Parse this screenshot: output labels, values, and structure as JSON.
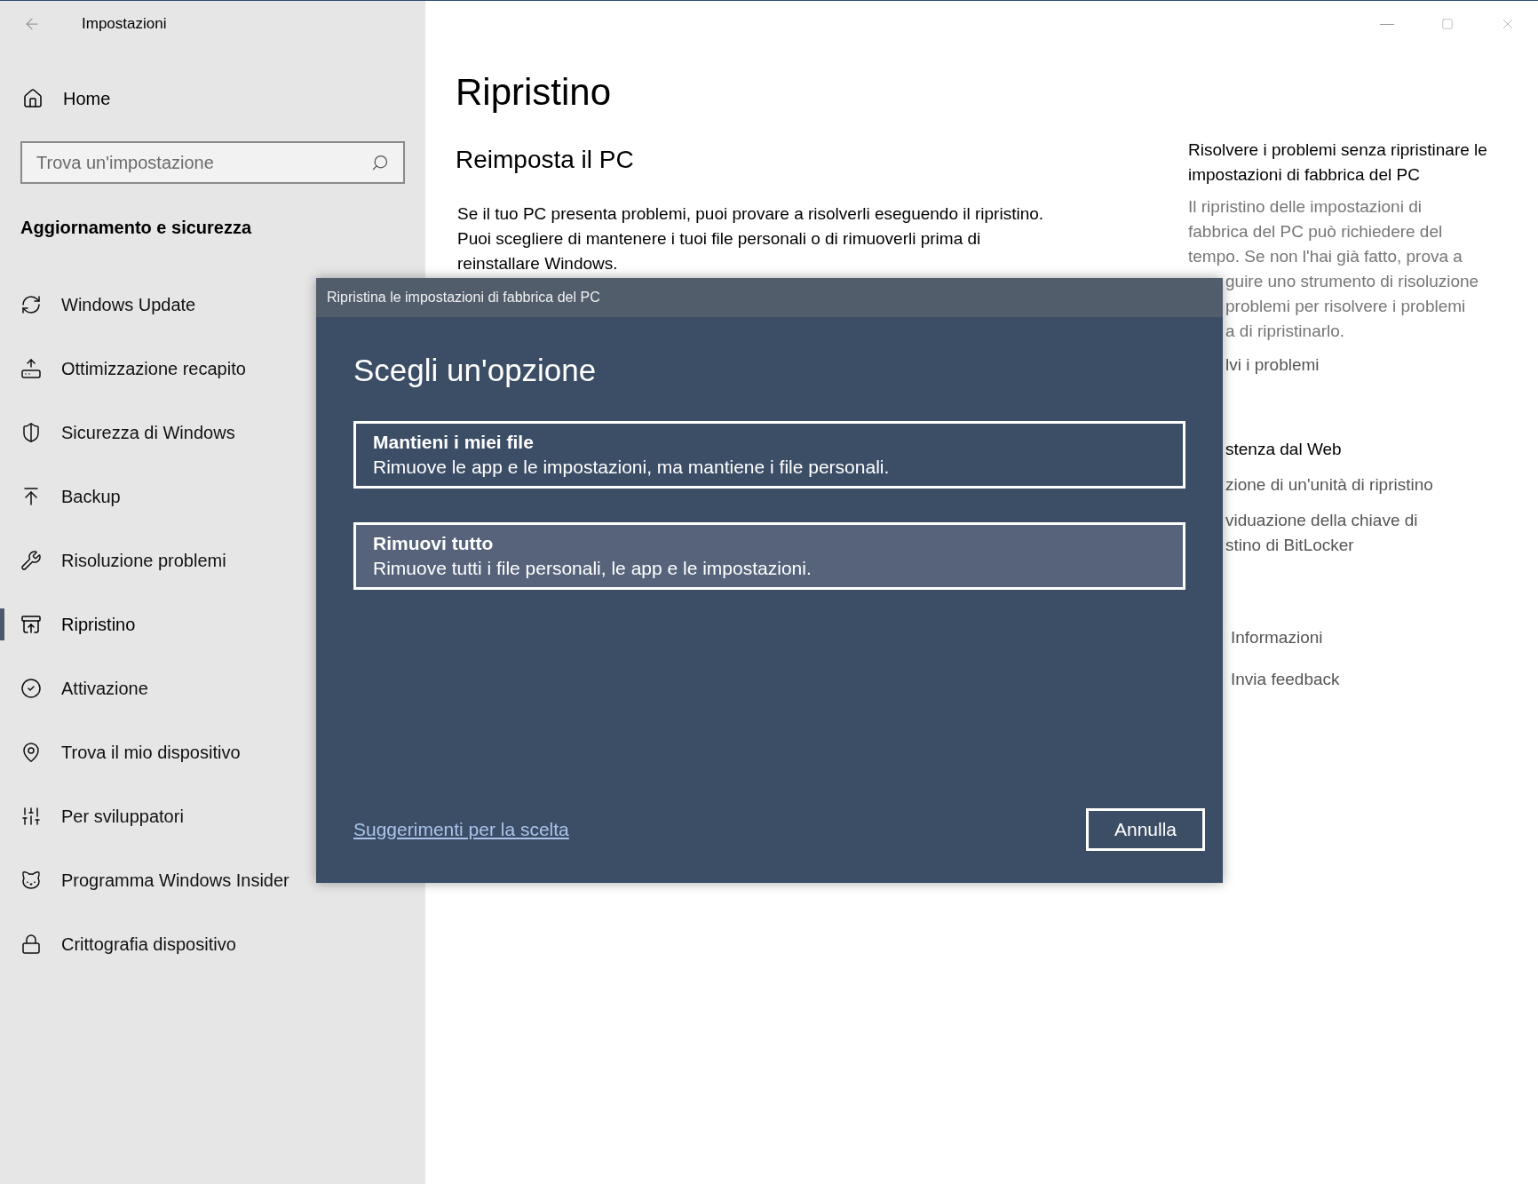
{
  "window": {
    "title": "Impostazioni"
  },
  "sidebar": {
    "home": "Home",
    "search": {
      "placeholder": "Trova un'impostazione"
    },
    "section_title": "Aggiornamento e sicurezza",
    "items": [
      {
        "label": "Windows Update",
        "selected": false
      },
      {
        "label": "Ottimizzazione recapito",
        "selected": false
      },
      {
        "label": "Sicurezza di Windows",
        "selected": false
      },
      {
        "label": "Backup",
        "selected": false
      },
      {
        "label": "Risoluzione problemi",
        "selected": false
      },
      {
        "label": "Ripristino",
        "selected": true
      },
      {
        "label": "Attivazione",
        "selected": false
      },
      {
        "label": "Trova il mio dispositivo",
        "selected": false
      },
      {
        "label": "Per sviluppatori",
        "selected": false
      },
      {
        "label": "Programma Windows Insider",
        "selected": false
      },
      {
        "label": "Crittografia dispositivo",
        "selected": false
      }
    ]
  },
  "main": {
    "title": "Ripristino",
    "section_title": "Reimposta il PC",
    "description": "Se il tuo PC presenta problemi, puoi provare a risolverli eseguendo il ripristino. Puoi scegliere di mantenere i tuoi file personali o di rimuoverli prima di reinstallare Windows."
  },
  "aside": {
    "heading": "Risolvere i problemi senza ripristinare le impostazioni di fabbrica del PC",
    "description_lines": [
      {
        "text": "Il ripristino delle impostazioni di",
        "kind": "full"
      },
      {
        "text": "fabbrica del PC può richiedere del",
        "kind": "full"
      },
      {
        "text": "tempo. Se non l'hai già fatto, prova a",
        "kind": "full"
      },
      {
        "text": "guire uno strumento di risoluzione",
        "kind": "partial"
      },
      {
        "text": "problemi per risolvere i problemi",
        "kind": "partial"
      },
      {
        "text": "a di ripristinarlo.",
        "kind": "partial"
      }
    ],
    "troubleshoot_link": "lvi i problemi",
    "web_help_title": "stenza dal Web",
    "web_links": [
      {
        "lines": [
          "zione di un'unità di ripristino"
        ]
      },
      {
        "lines": [
          "viduazione della chiave di",
          "stino di BitLocker"
        ]
      }
    ],
    "footer_links": [
      "Informazioni",
      "Invia feedback"
    ]
  },
  "dialog": {
    "title": "Ripristina le impostazioni di fabbrica del PC",
    "heading": "Scegli un'opzione",
    "options": [
      {
        "title": "Mantieni i miei file",
        "description": "Rimuove le app e le impostazioni, ma mantiene i file personali.",
        "selected": false
      },
      {
        "title": "Rimuovi tutto",
        "description": "Rimuove tutti i file personali, le app e le impostazioni.",
        "selected": true
      }
    ],
    "help_link": "Suggerimenti per la scelta",
    "cancel": "Annulla"
  }
}
